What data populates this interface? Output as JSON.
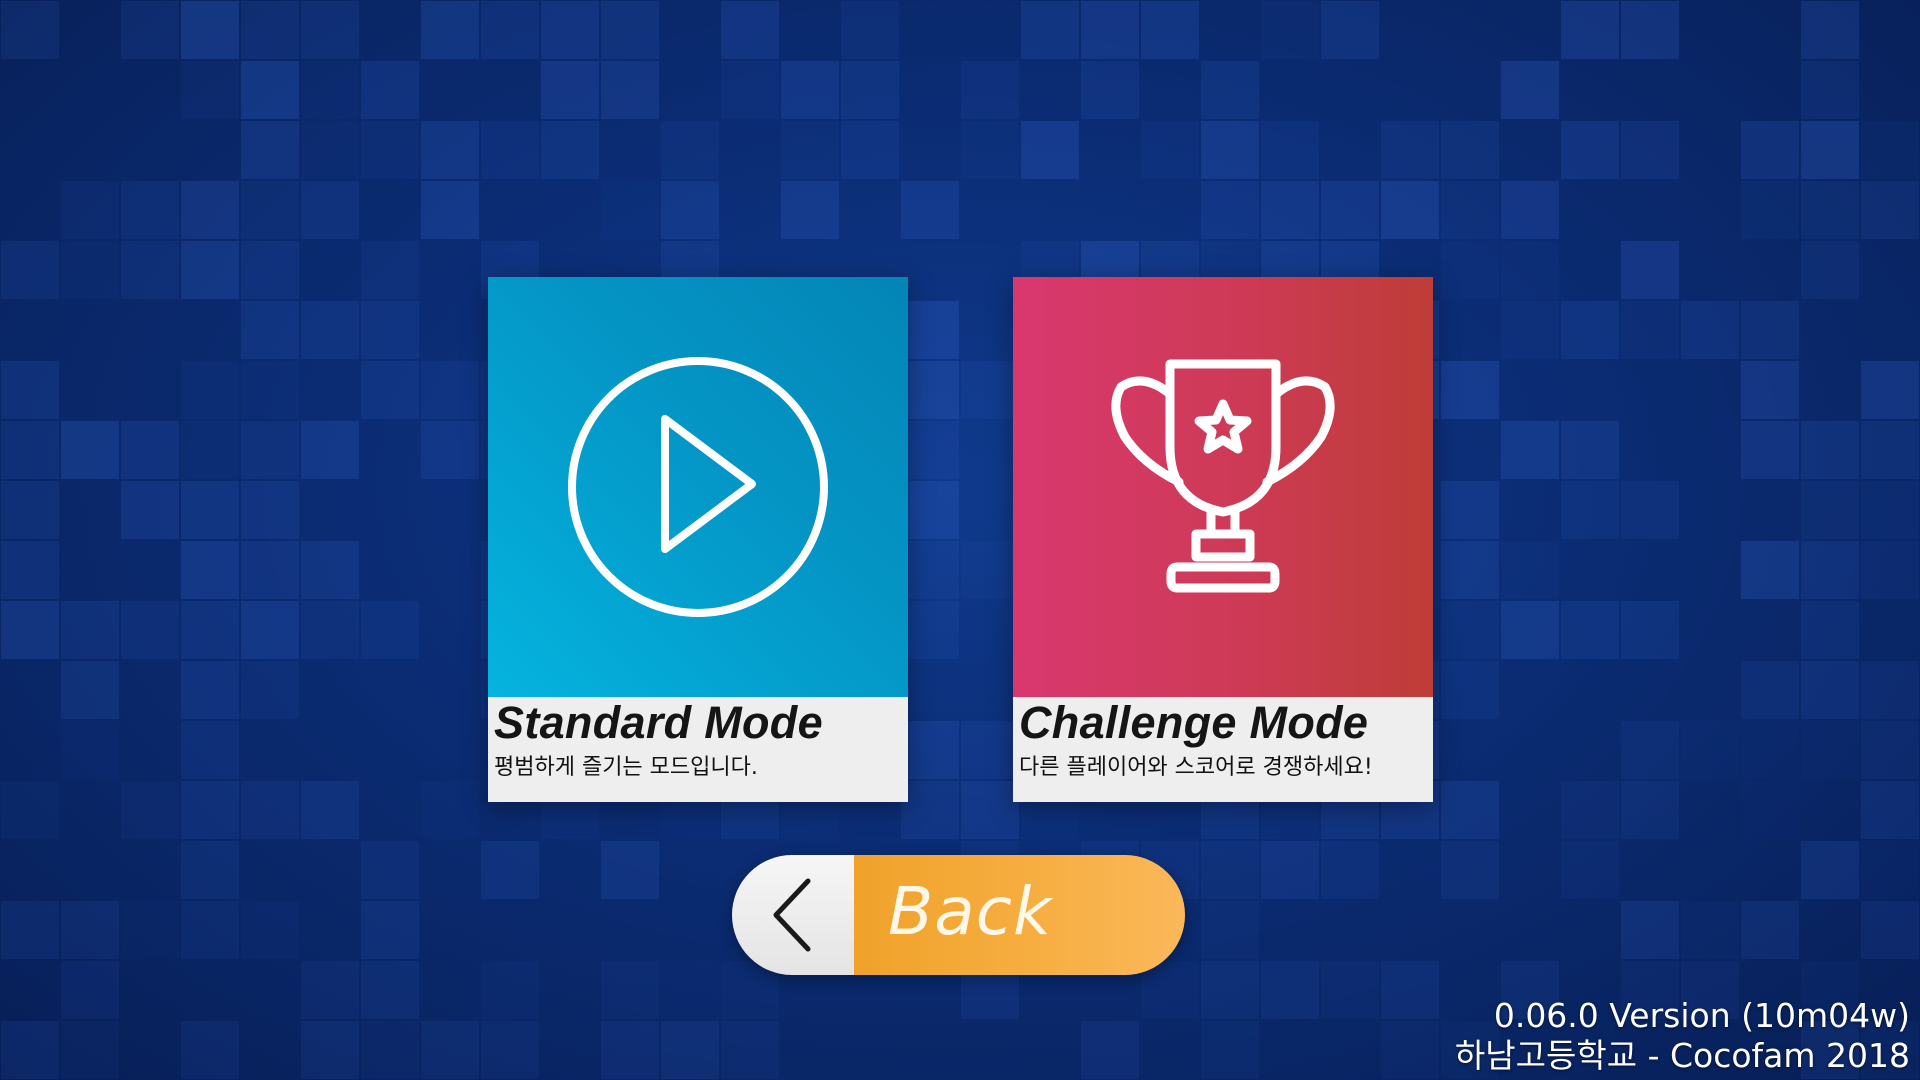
{
  "background": {
    "base_color": "#0b2c74",
    "tile_color": "#3c6fe0"
  },
  "modes": {
    "standard": {
      "title": "Standard Mode",
      "description": "평범하게 즐기는 모드입니다.",
      "icon": "play-circle-icon",
      "accent": "#04a2d2"
    },
    "challenge": {
      "title": "Challenge Mode",
      "description": "다른 플레이어와 스코어로 경쟁하세요!",
      "icon": "trophy-star-icon",
      "accent": "#cf3a55"
    }
  },
  "back_button": {
    "label": "Back",
    "icon": "chevron-left-icon",
    "accent": "#f6ad3f"
  },
  "footer": {
    "version": "0.06.0 Version (10m04w)",
    "credit": "하남고등학교 - Cocofam 2018"
  }
}
